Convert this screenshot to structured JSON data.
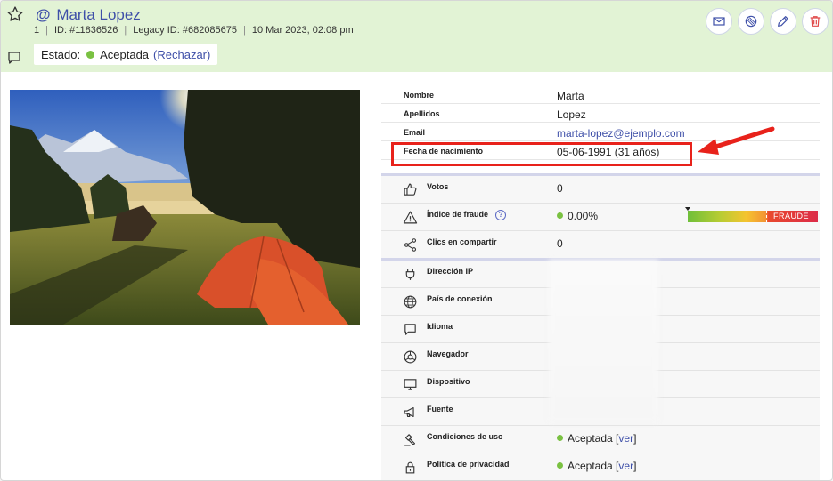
{
  "header": {
    "name": "Marta Lopez",
    "at_symbol": "@",
    "index": "1",
    "id_text": "ID: #11836526",
    "legacy_id_text": "Legacy ID: #682085675",
    "datetime": "10 Mar 2023, 02:08 pm",
    "status_label": "Estado:",
    "status_value": "Aceptada",
    "reject_label": "(Rechazar)"
  },
  "icons": {
    "star": "star-icon",
    "comment": "comment-icon",
    "mail": "mail-icon",
    "block": "block-icon",
    "edit": "pencil-icon",
    "delete": "trash-icon"
  },
  "personal": {
    "nombre_label": "Nombre",
    "nombre_value": "Marta",
    "apellidos_label": "Apellidos",
    "apellidos_value": "Lopez",
    "email_label": "Email",
    "email_value": "marta-lopez@ejemplo.com",
    "fecha_label": "Fecha de nacimiento",
    "fecha_value": "05-06-1991 (31 años)"
  },
  "stats": {
    "votos_label": "Votos",
    "votos_value": "0",
    "fraude_label": "Índice de fraude",
    "fraude_help": "?",
    "fraude_value": "0.00%",
    "fraude_level": 0.0,
    "fraude_tag": "FRAUDE",
    "clics_label": "Clics en compartir",
    "clics_value": "0"
  },
  "tech": {
    "ip_label": "Dirección IP",
    "pais_label": "País de conexión",
    "idioma_label": "Idioma",
    "navegador_label": "Navegador",
    "dispositivo_label": "Dispositivo",
    "fuente_label": "Fuente",
    "condiciones_label": "Condiciones de uso",
    "condiciones_value": "Aceptada",
    "condiciones_link": "ver",
    "privacidad_label": "Política de privacidad",
    "privacidad_value": "Aceptada",
    "privacidad_link": "ver"
  },
  "colors": {
    "accent": "#3e4fa8",
    "header_bg": "#e2f3d5",
    "status_green": "#7ac142",
    "highlight_red": "#e8221b",
    "delete_red": "#e04a4a"
  }
}
